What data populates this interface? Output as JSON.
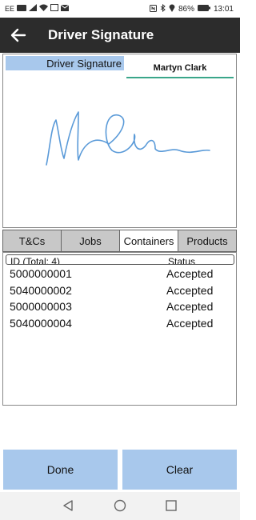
{
  "status_bar": {
    "carrier": "EE",
    "battery": "86%",
    "time": "13:01"
  },
  "app_bar": {
    "title": "Driver Signature"
  },
  "signature": {
    "label": "Driver Signature",
    "name": "Martyn Clark"
  },
  "tabs": [
    {
      "label": "T&Cs",
      "active": false
    },
    {
      "label": "Jobs",
      "active": false
    },
    {
      "label": "Containers",
      "active": true
    },
    {
      "label": "Products",
      "active": false
    }
  ],
  "list": {
    "header_id": "ID (Total: 4)",
    "header_status": "Status",
    "rows": [
      {
        "id": "5000000001",
        "status": "Accepted"
      },
      {
        "id": "5040000002",
        "status": "Accepted"
      },
      {
        "id": "5000000003",
        "status": "Accepted"
      },
      {
        "id": "5040000004",
        "status": "Accepted"
      }
    ]
  },
  "buttons": {
    "done": "Done",
    "clear": "Clear"
  },
  "colors": {
    "accent": "#a8c8ec",
    "appbar": "#2c2c2c",
    "signature_ink": "#5a9ad8",
    "name_underline": "#3aa68a"
  }
}
